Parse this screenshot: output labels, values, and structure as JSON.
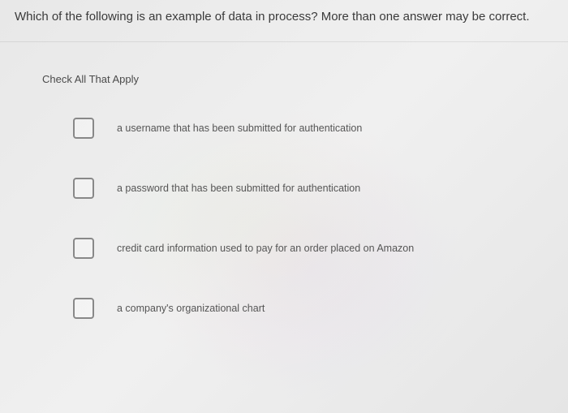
{
  "question": {
    "text": "Which of the following is an example of data in process? More than one answer may be correct."
  },
  "instruction": "Check All That Apply",
  "options": [
    {
      "label": "a username that has been submitted for authentication"
    },
    {
      "label": "a password that has been submitted for authentication"
    },
    {
      "label": "credit card information used to pay for an order placed on Amazon"
    },
    {
      "label": "a company's organizational chart"
    }
  ]
}
